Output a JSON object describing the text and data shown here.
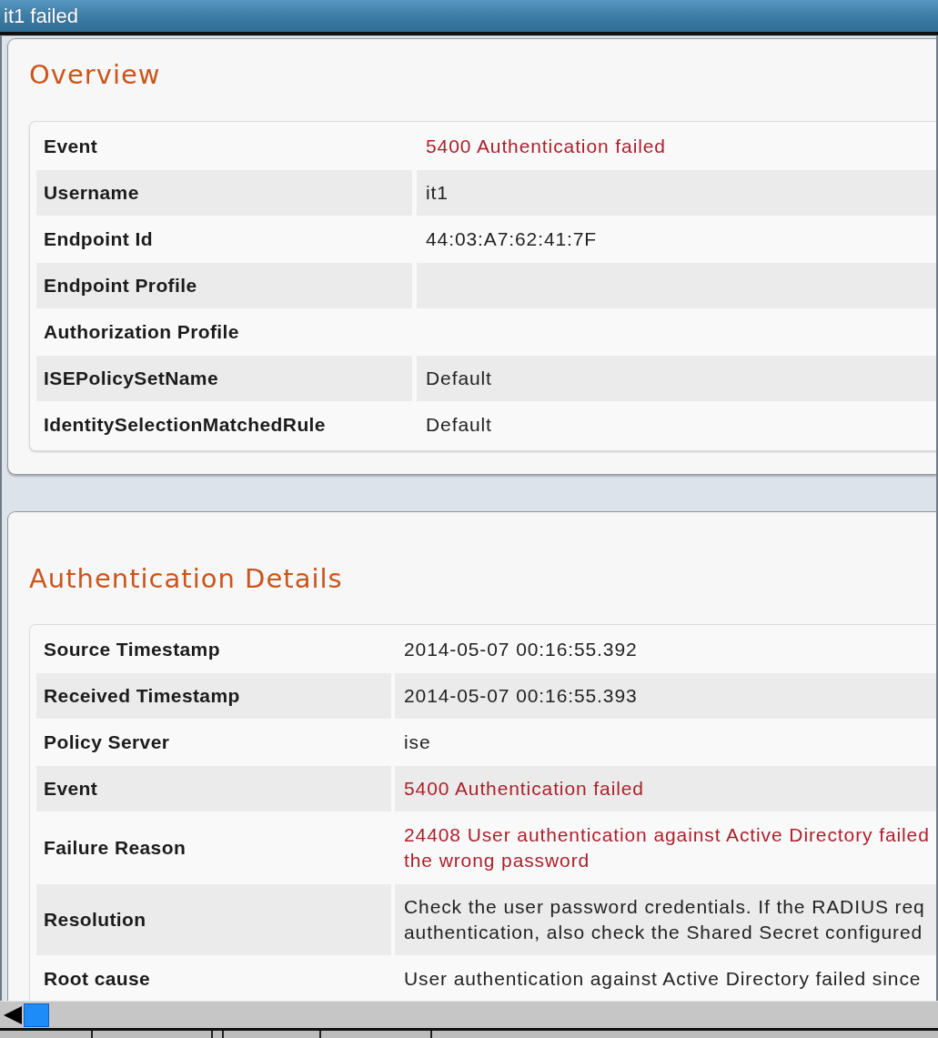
{
  "window": {
    "title": "it1 failed"
  },
  "sections": [
    {
      "title": "Overview",
      "rows": [
        {
          "label": "Event",
          "value": {
            "kind": "error",
            "lines": [
              "5400 Authentication failed"
            ]
          }
        },
        {
          "label": "Username",
          "value": {
            "kind": "plain",
            "lines": [
              "it1"
            ]
          }
        },
        {
          "label": "Endpoint Id",
          "value": {
            "kind": "plain",
            "lines": [
              "44:03:A7:62:41:7F"
            ]
          }
        },
        {
          "label": "Endpoint Profile"
        },
        {
          "label": "Authorization Profile"
        },
        {
          "label": "ISEPolicySetName",
          "value": {
            "kind": "plain",
            "lines": [
              "Default"
            ]
          }
        },
        {
          "label": "IdentitySelectionMatchedRule",
          "value": {
            "kind": "plain",
            "lines": [
              "Default"
            ]
          }
        }
      ]
    },
    {
      "title": "Authentication Details",
      "rows": [
        {
          "label": "Source Timestamp",
          "value": {
            "kind": "plain",
            "lines": [
              "2014-05-07 00:16:55.392"
            ]
          }
        },
        {
          "label": "Received Timestamp",
          "value": {
            "kind": "plain",
            "lines": [
              "2014-05-07 00:16:55.393"
            ]
          }
        },
        {
          "label": "Policy Server",
          "value": {
            "kind": "plain",
            "lines": [
              "ise"
            ]
          }
        },
        {
          "label": "Event",
          "value": {
            "kind": "error",
            "lines": [
              "5400 Authentication failed"
            ]
          }
        },
        {
          "label": "Failure Reason",
          "value": {
            "kind": "error",
            "lines": [
              "24408 User authentication against Active Directory failed",
              "the wrong password"
            ]
          }
        },
        {
          "label": "Resolution",
          "value": {
            "kind": "plain",
            "lines": [
              "Check the user password credentials. If the RADIUS req",
              "authentication, also check the Shared Secret configured"
            ]
          }
        },
        {
          "label": "Root cause",
          "value": {
            "kind": "plain",
            "lines": [
              "User authentication against Active Directory failed since"
            ]
          }
        }
      ]
    }
  ]
}
